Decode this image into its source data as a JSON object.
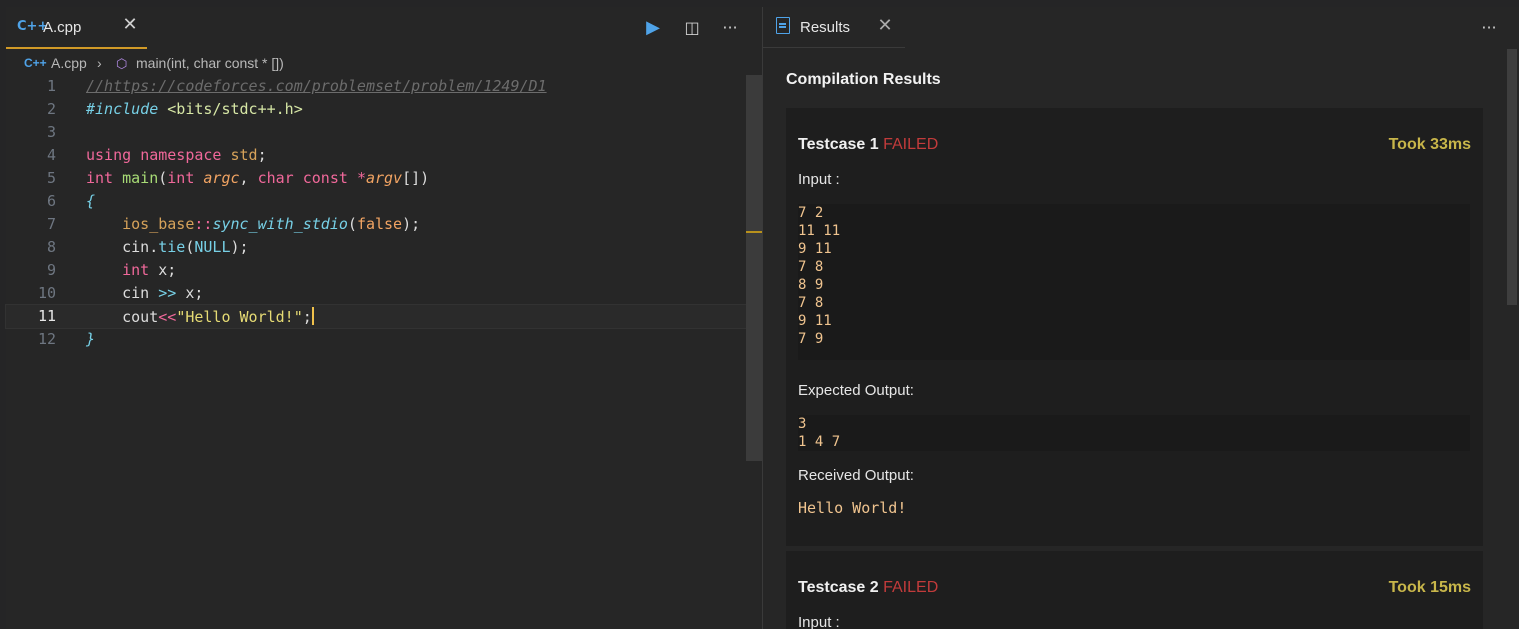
{
  "editor": {
    "tab": {
      "icon": "cpp-icon",
      "icon_text": "C++",
      "label": "A.cpp",
      "close": "✕"
    },
    "actions": {
      "run": "▶",
      "split": "◫",
      "more": "···"
    },
    "breadcrumb": {
      "file": "A.cpp",
      "separator": "›",
      "symbol": "main(int, char const * [])"
    },
    "active_line": 11,
    "line_numbers": [
      "1",
      "2",
      "3",
      "4",
      "5",
      "6",
      "7",
      "8",
      "9",
      "10",
      "11",
      "12"
    ]
  },
  "results": {
    "tab": {
      "label": "Results",
      "close": "✕"
    },
    "more": "···",
    "title": "Compilation Results",
    "testcases": [
      {
        "name": "Testcase 1",
        "status": "FAILED",
        "time": "Took 33ms",
        "input_label": "Input :",
        "input": "7 2\n11 11\n9 11\n7 8\n8 9\n7 8\n9 11\n7 9",
        "expected_label": "Expected Output:",
        "expected": "3\n1 4 7",
        "received_label": "Received Output:",
        "received": "Hello World!"
      },
      {
        "name": "Testcase 2",
        "status": "FAILED",
        "time": "Took 15ms",
        "input_label": "Input :"
      }
    ]
  },
  "colors": {
    "accent_tab": "#d19a27",
    "failed": "#c23b3b",
    "time": "#c8b64a",
    "output_text": "#f0c48f"
  }
}
